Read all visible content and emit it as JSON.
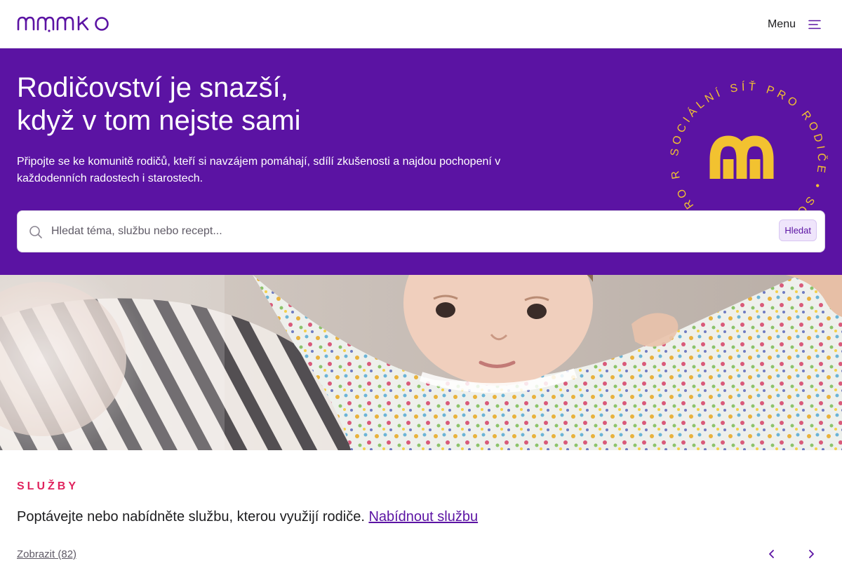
{
  "header": {
    "logo_text": "mamko",
    "menu_label": "Menu",
    "menu_icon": "hamburger-icon"
  },
  "hero": {
    "title_line1": "Rodičovství je snazší,",
    "title_line2": "když v tom nejste sami",
    "subtitle": "Připojte se ke komunitě rodičů, kteří si navzájem pomáhají, sdílí zkušenosti a najdou pochopení v každodenních radostech i starostech.",
    "seal_text": "SOCIÁLNÍ SÍŤ PRO RODIČE • SOCIÁLNÍ SÍŤ PRO RODIČE • ",
    "seal_icon": "mamko-m-icon"
  },
  "search": {
    "placeholder": "Hledat téma, službu nebo recept...",
    "value": "",
    "button_label": "Hledat",
    "icon": "search-icon"
  },
  "services": {
    "eyebrow": "SLUŽBY",
    "lead_text": "Poptávejte nebo nabídněte službu, kterou využijí rodiče.",
    "offer_link": "Nabídnout službu",
    "show_all": "Zobrazit (82)",
    "prev_icon": "chevron-left-icon",
    "next_icon": "chevron-right-icon"
  },
  "colors": {
    "brand_purple": "#5b13a3",
    "accent_yellow": "#f2c230",
    "eyebrow_red": "#e0245e"
  }
}
